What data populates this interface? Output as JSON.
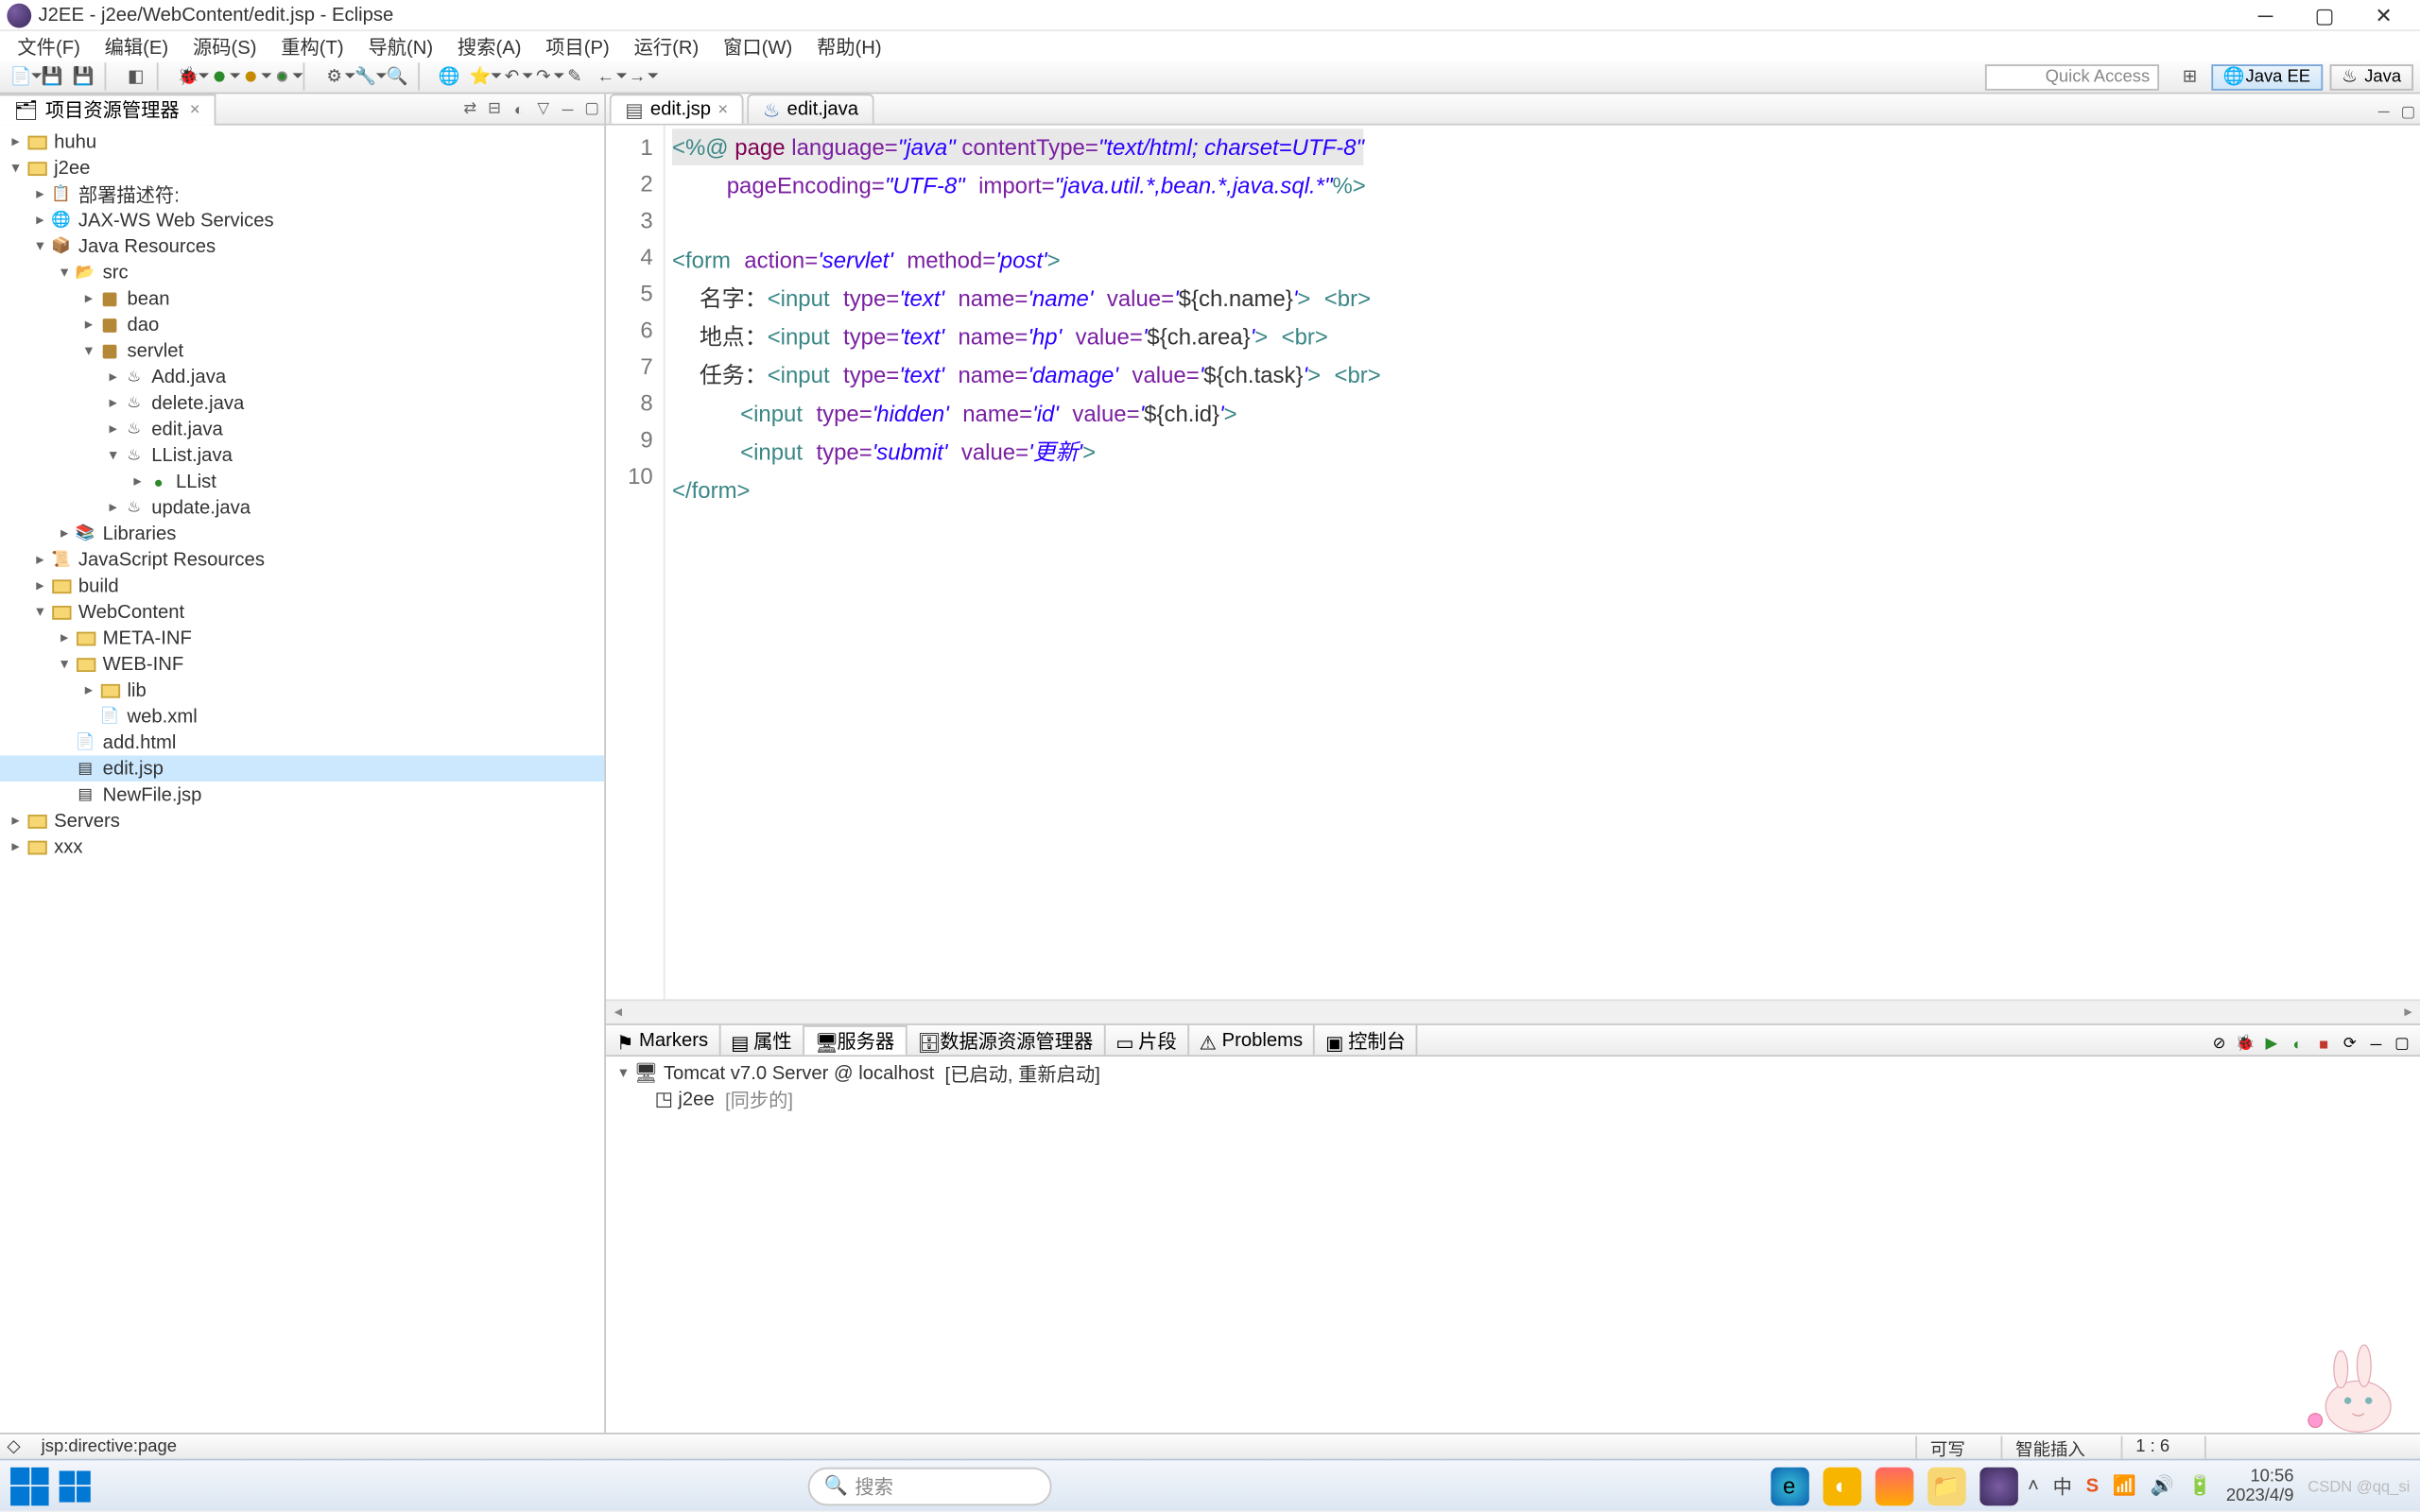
{
  "window": {
    "title": "J2EE - j2ee/WebContent/edit.jsp - Eclipse"
  },
  "menus": [
    "文件(F)",
    "编辑(E)",
    "源码(S)",
    "重构(T)",
    "导航(N)",
    "搜索(A)",
    "项目(P)",
    "运行(R)",
    "窗口(W)",
    "帮助(H)"
  ],
  "quick_access": "Quick Access",
  "perspectives": [
    {
      "label": "Java EE",
      "active": true
    },
    {
      "label": "Java",
      "active": false
    }
  ],
  "explorer": {
    "title": "项目资源管理器",
    "tree": [
      {
        "depth": 0,
        "exp": ">",
        "icon": "project",
        "label": "huhu"
      },
      {
        "depth": 0,
        "exp": "v",
        "icon": "project",
        "label": "j2ee"
      },
      {
        "depth": 1,
        "exp": ">",
        "icon": "desc",
        "label": "部署描述符:"
      },
      {
        "depth": 1,
        "exp": ">",
        "icon": "ws",
        "label": "JAX-WS Web Services"
      },
      {
        "depth": 1,
        "exp": "v",
        "icon": "jres",
        "label": "Java Resources"
      },
      {
        "depth": 2,
        "exp": "v",
        "icon": "src",
        "label": "src"
      },
      {
        "depth": 3,
        "exp": ">",
        "icon": "pkg",
        "label": "bean"
      },
      {
        "depth": 3,
        "exp": ">",
        "icon": "pkg",
        "label": "dao"
      },
      {
        "depth": 3,
        "exp": "v",
        "icon": "pkg",
        "label": "servlet"
      },
      {
        "depth": 4,
        "exp": ">",
        "icon": "java",
        "label": "Add.java"
      },
      {
        "depth": 4,
        "exp": ">",
        "icon": "java",
        "label": "delete.java"
      },
      {
        "depth": 4,
        "exp": ">",
        "icon": "java",
        "label": "edit.java"
      },
      {
        "depth": 4,
        "exp": "v",
        "icon": "java",
        "label": "LList.java"
      },
      {
        "depth": 5,
        "exp": ">",
        "icon": "class",
        "label": "LList"
      },
      {
        "depth": 4,
        "exp": ">",
        "icon": "java",
        "label": "update.java"
      },
      {
        "depth": 2,
        "exp": ">",
        "icon": "lib",
        "label": "Libraries"
      },
      {
        "depth": 1,
        "exp": ">",
        "icon": "jsres",
        "label": "JavaScript Resources"
      },
      {
        "depth": 1,
        "exp": ">",
        "icon": "folder",
        "label": "build"
      },
      {
        "depth": 1,
        "exp": "v",
        "icon": "folder",
        "label": "WebContent"
      },
      {
        "depth": 2,
        "exp": ">",
        "icon": "folder",
        "label": "META-INF"
      },
      {
        "depth": 2,
        "exp": "v",
        "icon": "folder",
        "label": "WEB-INF"
      },
      {
        "depth": 3,
        "exp": ">",
        "icon": "folder",
        "label": "lib"
      },
      {
        "depth": 3,
        "exp": "",
        "icon": "xml",
        "label": "web.xml"
      },
      {
        "depth": 2,
        "exp": "",
        "icon": "html",
        "label": "add.html"
      },
      {
        "depth": 2,
        "exp": "",
        "icon": "jsp",
        "label": "edit.jsp",
        "selected": true
      },
      {
        "depth": 2,
        "exp": "",
        "icon": "jsp",
        "label": "NewFile.jsp"
      },
      {
        "depth": 0,
        "exp": ">",
        "icon": "project",
        "label": "Servers"
      },
      {
        "depth": 0,
        "exp": ">",
        "icon": "project",
        "label": "xxx"
      }
    ]
  },
  "editor": {
    "tabs": [
      {
        "label": "edit.jsp",
        "active": true
      },
      {
        "label": "edit.java",
        "active": false
      }
    ],
    "line_count": 10,
    "cursor_line": 1,
    "cursor_col": 6
  },
  "bottom": {
    "tabs": [
      "Markers",
      "属性",
      "服务器",
      "数据源资源管理器",
      "片段",
      "Problems",
      "控制台"
    ],
    "active_tab": 2,
    "server": {
      "name": "Tomcat v7.0 Server @ localhost",
      "status": "[已启动, 重新启动]",
      "module": "j2ee",
      "module_status": "[同步的]"
    }
  },
  "status": {
    "left": "jsp:directive:page",
    "mode1": "可写",
    "mode2": "智能插入",
    "pos": "1 : 6"
  },
  "taskbar": {
    "search_placeholder": "搜索",
    "time": "10:56",
    "date": "2023/4/9"
  },
  "watermark": "CSDN @qq_si"
}
